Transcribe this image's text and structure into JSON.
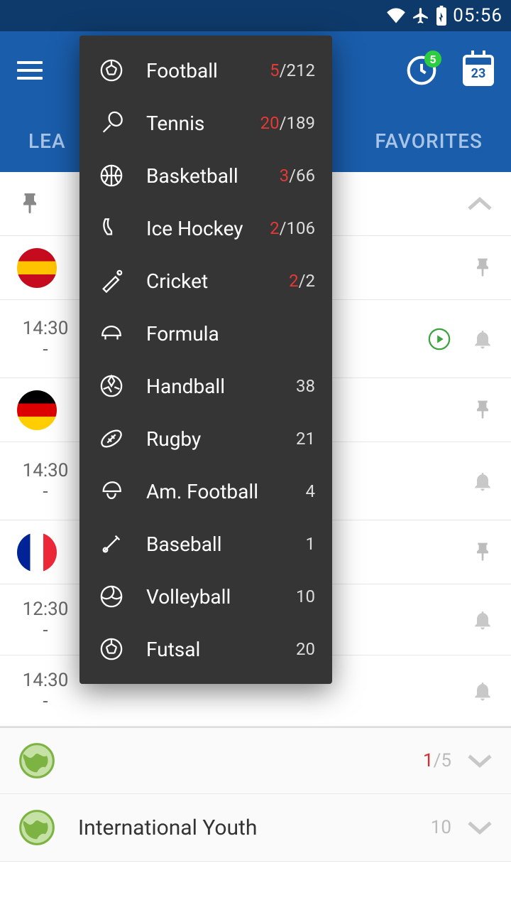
{
  "status": {
    "time": "05:56"
  },
  "header": {
    "clock_badge": "5",
    "calendar_day": "23"
  },
  "tabs": {
    "left": "LEA",
    "right": "FAVORITES"
  },
  "sports": [
    {
      "icon": "football",
      "label": "Football",
      "live": "5",
      "total": "212"
    },
    {
      "icon": "tennis",
      "label": "Tennis",
      "live": "20",
      "total": "189"
    },
    {
      "icon": "basketball",
      "label": "Basketball",
      "live": "3",
      "total": "66"
    },
    {
      "icon": "icehockey",
      "label": "Ice Hockey",
      "live": "2",
      "total": "106"
    },
    {
      "icon": "cricket",
      "label": "Cricket",
      "live": "2",
      "total": "2"
    },
    {
      "icon": "formula",
      "label": "Formula",
      "live": "",
      "total": ""
    },
    {
      "icon": "handball",
      "label": "Handball",
      "live": "",
      "total": "38"
    },
    {
      "icon": "rugby",
      "label": "Rugby",
      "live": "",
      "total": "21"
    },
    {
      "icon": "amfootball",
      "label": "Am. Football",
      "live": "",
      "total": "4"
    },
    {
      "icon": "baseball",
      "label": "Baseball",
      "live": "",
      "total": "1"
    },
    {
      "icon": "volleyball",
      "label": "Volleyball",
      "live": "",
      "total": "10"
    },
    {
      "icon": "futsal",
      "label": "Futsal",
      "live": "",
      "total": "20"
    }
  ],
  "bg": {
    "t1": "14:30",
    "d1": "-",
    "t2": "14:30",
    "d2": "-",
    "t3": "12:30",
    "d3": "-",
    "t4": "14:30",
    "d4": "-",
    "section1_live": "1",
    "section1_total": "/5",
    "section2_label": "International Youth",
    "section2_total": "10"
  }
}
